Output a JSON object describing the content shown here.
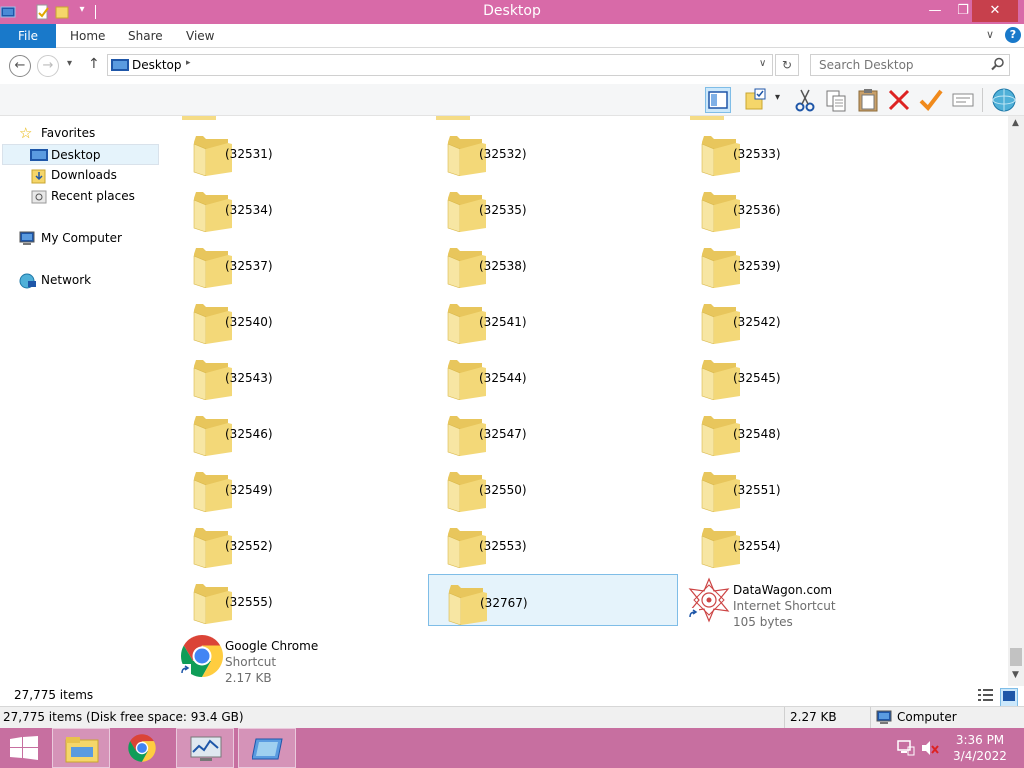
{
  "window": {
    "title": "Desktop"
  },
  "ribbon": {
    "tabs": [
      "File",
      "Home",
      "Share",
      "View"
    ]
  },
  "address": {
    "location": "Desktop"
  },
  "search": {
    "placeholder": "Search Desktop"
  },
  "nav": {
    "favorites": "Favorites",
    "desktop": "Desktop",
    "downloads": "Downloads",
    "recent": "Recent places",
    "computer": "My Computer",
    "network": "Network"
  },
  "folders": [
    "(32531)",
    "(32532)",
    "(32533)",
    "(32534)",
    "(32535)",
    "(32536)",
    "(32537)",
    "(32538)",
    "(32539)",
    "(32540)",
    "(32541)",
    "(32542)",
    "(32543)",
    "(32544)",
    "(32545)",
    "(32546)",
    "(32547)",
    "(32548)",
    "(32549)",
    "(32550)",
    "(32551)",
    "(32552)",
    "(32553)",
    "(32554)",
    "(32555)",
    "(32767)"
  ],
  "shortcuts": {
    "datawagon": {
      "name": "DataWagon.com",
      "type": "Internet Shortcut",
      "size": "105 bytes"
    },
    "chrome": {
      "name": "Google Chrome",
      "type": "Shortcut",
      "size": "2.17 KB"
    }
  },
  "status": {
    "count": "27,775 items",
    "summary": "27,775 items (Disk free space: 93.4 GB)",
    "size": "2.27 KB",
    "location": "Computer"
  },
  "clock": {
    "time": "3:36 PM",
    "date": "3/4/2022"
  },
  "colors": {
    "titlebar": "#d86aa8",
    "taskbar": "#c76fa0",
    "file_tab": "#1979ca",
    "selection": "#e5f3fb"
  }
}
